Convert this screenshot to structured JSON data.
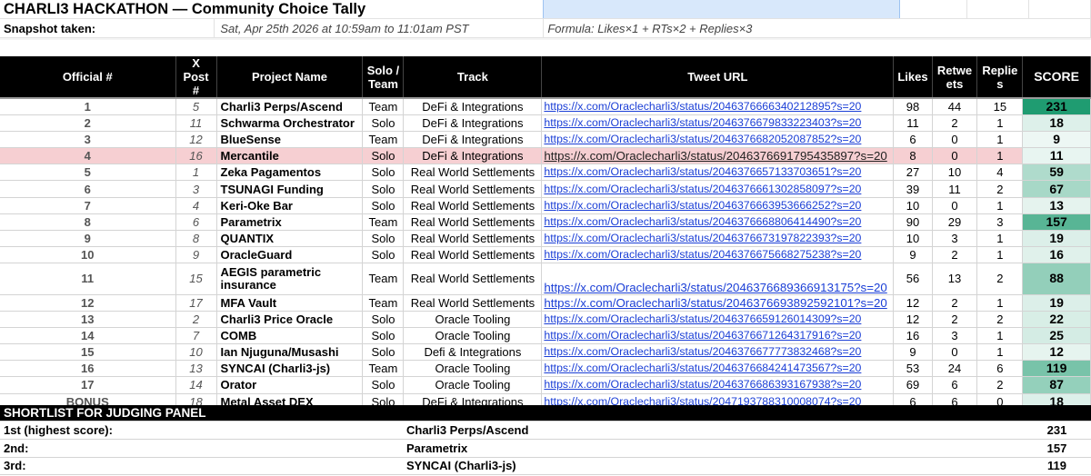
{
  "header": {
    "title": "CHARLI3 HACKATHON — Community Choice Tally",
    "snapshot_label": "Snapshot taken:",
    "snapshot_value": "Sat, Apr 25th 2026 at 10:59am to 11:01am PST",
    "formula": "Formula: Likes×1 + RTs×2 + Replies×3"
  },
  "columns": {
    "official": "Official #",
    "xpost": "X Post #",
    "name": "Project Name",
    "solo": "Solo / Team",
    "track": "Track",
    "url": "Tweet URL",
    "likes": "Likes",
    "retweets": "Retweets",
    "replies": "Replies",
    "score": "SCORE"
  },
  "rows": [
    {
      "official": "1",
      "xpost": "5",
      "name": "Charli3 Perps/Ascend",
      "solo": "Team",
      "track": "DeFi & Integrations",
      "url": "https://x.com/Oraclecharli3/status/2046376666340212895?s=20",
      "likes": "98",
      "retweets": "44",
      "replies": "15",
      "score": "231"
    },
    {
      "official": "2",
      "xpost": "11",
      "name": "Schwarma Orchestrator",
      "solo": "Solo",
      "track": "DeFi & Integrations",
      "url": "https://x.com/Oraclecharli3/status/2046376679833223403?s=20",
      "likes": "11",
      "retweets": "2",
      "replies": "1",
      "score": "18"
    },
    {
      "official": "3",
      "xpost": "12",
      "name": "BlueSense",
      "solo": "Team",
      "track": "DeFi & Integrations",
      "url": "https://x.com/Oraclecharli3/status/2046376682052087852?s=20",
      "likes": "6",
      "retweets": "0",
      "replies": "1",
      "score": "9"
    },
    {
      "official": "4",
      "xpost": "16",
      "name": "Mercantile",
      "solo": "Solo",
      "track": "DeFi & Integrations",
      "url": "https://x.com/Oraclecharli3/status/2046376691795435897?s=20",
      "likes": "8",
      "retweets": "0",
      "replies": "1",
      "score": "11"
    },
    {
      "official": "5",
      "xpost": "1",
      "name": "Zeka Pagamentos",
      "solo": "Solo",
      "track": "Real World Settlements",
      "url": "https://x.com/Oraclecharli3/status/2046376657133703651?s=20",
      "likes": "27",
      "retweets": "10",
      "replies": "4",
      "score": "59"
    },
    {
      "official": "6",
      "xpost": "3",
      "name": "TSUNAGI Funding",
      "solo": "Solo",
      "track": "Real World Settlements",
      "url": "https://x.com/Oraclecharli3/status/2046376661302858097?s=20",
      "likes": "39",
      "retweets": "11",
      "replies": "2",
      "score": "67"
    },
    {
      "official": "7",
      "xpost": "4",
      "name": "Keri-Oke Bar",
      "solo": "Solo",
      "track": "Real World Settlements",
      "url": "https://x.com/Oraclecharli3/status/2046376663953666252?s=20",
      "likes": "10",
      "retweets": "0",
      "replies": "1",
      "score": "13"
    },
    {
      "official": "8",
      "xpost": "6",
      "name": "Parametrix",
      "solo": "Team",
      "track": "Real World Settlements",
      "url": "https://x.com/Oraclecharli3/status/2046376668806414490?s=20",
      "likes": "90",
      "retweets": "29",
      "replies": "3",
      "score": "157"
    },
    {
      "official": "9",
      "xpost": "8",
      "name": "QUANTIX",
      "solo": "Solo",
      "track": "Real World Settlements",
      "url": "https://x.com/Oraclecharli3/status/2046376673197822393?s=20",
      "likes": "10",
      "retweets": "3",
      "replies": "1",
      "score": "19"
    },
    {
      "official": "10",
      "xpost": "9",
      "name": "OracleGuard",
      "solo": "Solo",
      "track": "Real World Settlements",
      "url": "https://x.com/Oraclecharli3/status/2046376675668275238?s=20",
      "likes": "9",
      "retweets": "2",
      "replies": "1",
      "score": "16"
    },
    {
      "official": "11",
      "xpost": "15",
      "name": "AEGIS parametric insurance",
      "solo": "Team",
      "track": "Real World Settlements",
      "url": "https://x.com/Oraclecharli3/status/2046376689366913175?s=20",
      "likes": "56",
      "retweets": "13",
      "replies": "2",
      "score": "88"
    },
    {
      "official": "12",
      "xpost": "17",
      "name": "MFA Vault",
      "solo": "Team",
      "track": "Real World Settlements",
      "url": "https://x.com/Oraclecharli3/status/2046376693892592101?s=20",
      "likes": "12",
      "retweets": "2",
      "replies": "1",
      "score": "19"
    },
    {
      "official": "13",
      "xpost": "2",
      "name": "Charli3 Price Oracle",
      "solo": "Solo",
      "track": "Oracle Tooling",
      "url": "https://x.com/Oraclecharli3/status/2046376659126014309?s=20",
      "likes": "12",
      "retweets": "2",
      "replies": "2",
      "score": "22"
    },
    {
      "official": "14",
      "xpost": "7",
      "name": "COMB",
      "solo": "Solo",
      "track": "Oracle Tooling",
      "url": "https://x.com/Oraclecharli3/status/2046376671264317916?s=20",
      "likes": "16",
      "retweets": "3",
      "replies": "1",
      "score": "25"
    },
    {
      "official": "15",
      "xpost": "10",
      "name": "Ian Njuguna/Musashi",
      "solo": "Solo",
      "track": "Defi & Integrations",
      "url": "https://x.com/Oraclecharli3/status/2046376677773832468?s=20",
      "likes": "9",
      "retweets": "0",
      "replies": "1",
      "score": "12"
    },
    {
      "official": "16",
      "xpost": "13",
      "name": "SYNCAI (Charli3-js)",
      "solo": "Team",
      "track": "Oracle Tooling",
      "url": "https://x.com/Oraclecharli3/status/2046376684241473567?s=20",
      "likes": "53",
      "retweets": "24",
      "replies": "6",
      "score": "119"
    },
    {
      "official": "17",
      "xpost": "14",
      "name": "Orator",
      "solo": "Solo",
      "track": "Oracle Tooling",
      "url": "https://x.com/Oraclecharli3/status/2046376686393167938?s=20",
      "likes": "69",
      "retweets": "6",
      "replies": "2",
      "score": "87"
    },
    {
      "official": "BONUS",
      "xpost": "18",
      "name": "Metal Asset DEX",
      "solo": "Solo",
      "track": "DeFi & Integrations",
      "url": "https://x.com/Oraclecharli3/status/2047193788310008074?s=20",
      "likes": "6",
      "retweets": "6",
      "replies": "0",
      "score": "18"
    }
  ],
  "shortlist": {
    "title": "SHORTLIST FOR JUDGING PANEL",
    "entries": [
      {
        "place": "1st (highest score):",
        "name": "Charli3 Perps/Ascend",
        "score": "231"
      },
      {
        "place": "2nd:",
        "name": "Parametrix",
        "score": "157"
      },
      {
        "place": "3rd:",
        "name": "SYNCAI (Charli3-js)",
        "score": "119"
      }
    ]
  },
  "colors": {
    "header_bg": "#000000",
    "highlight_row": "#f6cfd2",
    "link": "#1a3ed6",
    "score_scale_low": "#ffffff",
    "score_scale_high": "#1f9c71"
  },
  "state": {
    "highlighted_official": "4",
    "large_url_officials": [
      "4",
      "11",
      "12"
    ],
    "tall_row_officials": [
      "11"
    ]
  }
}
